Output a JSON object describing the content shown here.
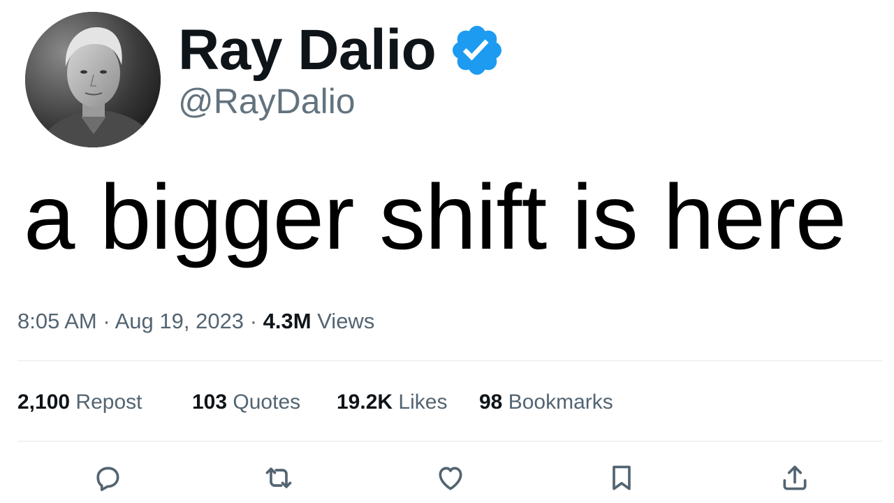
{
  "author": {
    "display_name": "Ray Dalio",
    "handle": "@RayDalio",
    "verified": true,
    "verified_color": "#1d9bf0"
  },
  "tweet": {
    "text": "a bigger shift is here",
    "time": "8:05 AM",
    "separator": "·",
    "date": "Aug 19, 2023",
    "views_count": "4.3M",
    "views_label": "Views"
  },
  "stats": [
    {
      "count": "2,100",
      "label": "Repost"
    },
    {
      "count": "103",
      "label": "Quotes"
    },
    {
      "count": "19.2K",
      "label": "Likes"
    },
    {
      "count": "98",
      "label": "Bookmarks"
    }
  ],
  "actions": [
    {
      "name": "reply",
      "icon": "speech-bubble-icon"
    },
    {
      "name": "repost",
      "icon": "repost-arrows-icon"
    },
    {
      "name": "like",
      "icon": "heart-icon"
    },
    {
      "name": "bookmark",
      "icon": "bookmark-icon"
    },
    {
      "name": "share",
      "icon": "upload-share-icon"
    }
  ],
  "colors": {
    "text_primary": "#0f1419",
    "text_secondary": "#536471",
    "divider": "#e6e9ea"
  }
}
